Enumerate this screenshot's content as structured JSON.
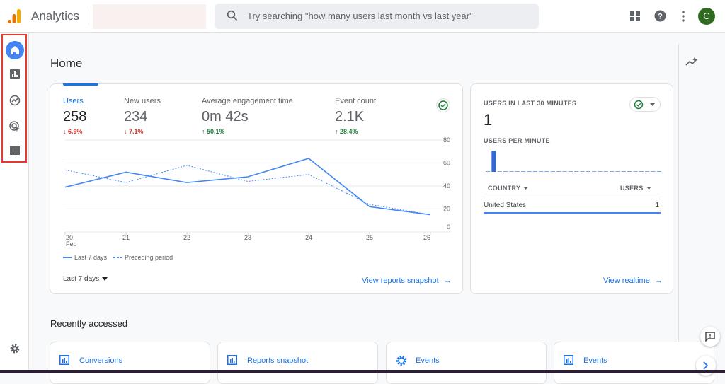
{
  "header": {
    "app_title": "Analytics",
    "search_placeholder": "Try searching \"how many users last month vs last year\"",
    "avatar_letter": "C"
  },
  "sidebar": {
    "items": [
      {
        "name": "home",
        "active": true
      },
      {
        "name": "reports"
      },
      {
        "name": "explore"
      },
      {
        "name": "advertising"
      },
      {
        "name": "configure"
      }
    ],
    "settings": "settings"
  },
  "page_title": "Home",
  "metrics": [
    {
      "label": "Users",
      "value": "258",
      "change": "6.9%",
      "direction": "down",
      "selected": true
    },
    {
      "label": "New users",
      "value": "234",
      "change": "7.1%",
      "direction": "down"
    },
    {
      "label": "Average engagement time",
      "value": "0m 42s",
      "change": "50.1%",
      "direction": "up"
    },
    {
      "label": "Event count",
      "value": "2.1K",
      "change": "28.4%",
      "direction": "up"
    }
  ],
  "chart_data": {
    "type": "line",
    "x": [
      "20",
      "21",
      "22",
      "23",
      "24",
      "25",
      "26"
    ],
    "x_sublabel": "Feb",
    "ylim": [
      0,
      80
    ],
    "yticks": [
      "80",
      "60",
      "40",
      "20",
      "0"
    ],
    "grid": true,
    "legend_position": "bottom-left",
    "series": [
      {
        "name": "Last 7 days",
        "style": "solid",
        "color": "#4285f4",
        "values": [
          39,
          52,
          43,
          48,
          64,
          22,
          15
        ]
      },
      {
        "name": "Preceding period",
        "style": "dashed",
        "color": "#4285f4",
        "values": [
          54,
          43,
          58,
          44,
          50,
          24,
          15
        ]
      }
    ]
  },
  "date_range": "Last 7 days",
  "view_reports_link": "View reports snapshot",
  "realtime": {
    "title": "USERS IN LAST 30 MINUTES",
    "value": "1",
    "per_minute_label": "USERS PER MINUTE",
    "per_minute_values": [
      0,
      1,
      0,
      0,
      0,
      0,
      0,
      0,
      0,
      0,
      0,
      0,
      0,
      0,
      0,
      0,
      0,
      0,
      0,
      0,
      0,
      0,
      0,
      0,
      0,
      0,
      0,
      0,
      0,
      0
    ],
    "col_country": "COUNTRY",
    "col_users": "USERS",
    "rows": [
      {
        "country": "United States",
        "users": "1"
      }
    ],
    "link": "View realtime"
  },
  "recent": {
    "title": "Recently accessed",
    "items": [
      {
        "label": "Conversions",
        "icon": "report"
      },
      {
        "label": "Reports snapshot",
        "icon": "report"
      },
      {
        "label": "Events",
        "icon": "gear"
      },
      {
        "label": "Events",
        "icon": "report"
      }
    ]
  },
  "colors": {
    "accent": "#1a73e8",
    "down": "#d93025",
    "up": "#188038",
    "highlight": "#e53935"
  }
}
